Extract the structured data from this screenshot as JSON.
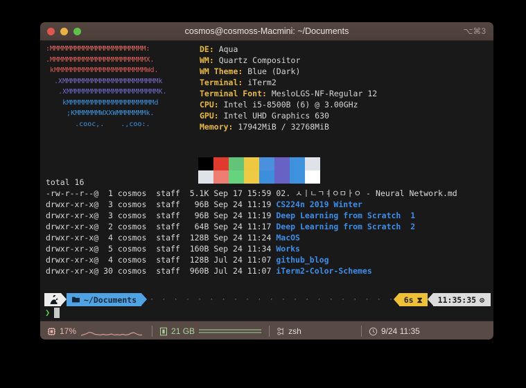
{
  "window": {
    "title": "cosmos@cosmoss-Macmini: ~/Documents",
    "shortcut": "⌥⌘3",
    "controls": {
      "close": "close-button",
      "minimize": "minimize-button",
      "maximize": "maximize-button"
    }
  },
  "neofetch": {
    "ascii_lines": [
      ":MMMMMMMMMMMMMMMMMMMMMMM:",
      ".MMMMMMMMMMMMMMMMMMMMMMMX.",
      " kMMMMMMMMMMMMMMMMMMMMMMWd.",
      "  .XMMMMMMMMMMMMMMMMMMMMMMMk",
      "   .XMMMMMMMMMMMMMMMMMMMMMMK.",
      "    kMMMMMMMMMMMMMMMMMMMMMd",
      "     ;KMMMMMMWXXWMMMMMMMk.",
      "       .cooc,.    .,coo:."
    ],
    "info": [
      {
        "key": "DE",
        "value": "Aqua"
      },
      {
        "key": "WM",
        "value": "Quartz Compositor"
      },
      {
        "key": "WM Theme",
        "value": "Blue (Dark)"
      },
      {
        "key": "Terminal",
        "value": "iTerm2"
      },
      {
        "key": "Terminal Font",
        "value": "MesloLGS-NF-Regular 12"
      },
      {
        "key": "CPU",
        "value": "Intel i5-8500B (6) @ 3.00GHz"
      },
      {
        "key": "GPU",
        "value": "Intel UHD Graphics 630"
      },
      {
        "key": "Memory",
        "value": "17942MiB / 32768MiB"
      }
    ],
    "palette": {
      "row1": [
        "#000000",
        "#e0392e",
        "#63c378",
        "#eec83f",
        "#4a90dd",
        "#6762c4",
        "#3f92dd",
        "#dfe2e8"
      ],
      "row2": [
        "#dfe2e8",
        "#ef7e72",
        "#66d37e",
        "#eecb42",
        "#3d8fdd",
        "#6762c4",
        "#3f92dd",
        "#ffffff"
      ]
    }
  },
  "ls": {
    "total": "total 16",
    "rows": [
      {
        "perms": "-rw-r--r--@",
        "links": " 1",
        "user": "cosmos",
        "group": "staff",
        "size": "5.1K",
        "month": "Sep",
        "day": "17",
        "time": "15:59",
        "name": "02. ㅅㅣㄴㄱㅕㅇㅁㅏㅇ - Neural Network.md",
        "kind": "file"
      },
      {
        "perms": "drwxr-xr-x@",
        "links": " 3",
        "user": "cosmos",
        "group": "staff",
        "size": "96B",
        "month": "Sep",
        "day": "24",
        "time": "11:19",
        "name": "CS224n 2019 Winter",
        "kind": "dir"
      },
      {
        "perms": "drwxr-xr-x@",
        "links": " 3",
        "user": "cosmos",
        "group": "staff",
        "size": "96B",
        "month": "Sep",
        "day": "24",
        "time": "11:19",
        "name": "Deep Learning from Scratch  1",
        "kind": "dir"
      },
      {
        "perms": "drwxr-xr-x@",
        "links": " 2",
        "user": "cosmos",
        "group": "staff",
        "size": "64B",
        "month": "Sep",
        "day": "24",
        "time": "11:17",
        "name": "Deep Learning from Scratch  2",
        "kind": "dir"
      },
      {
        "perms": "drwxr-xr-x@",
        "links": " 4",
        "user": "cosmos",
        "group": "staff",
        "size": "128B",
        "month": "Sep",
        "day": "24",
        "time": "11:24",
        "name": "MacOS",
        "kind": "dir"
      },
      {
        "perms": "drwxr-xr-x@",
        "links": " 5",
        "user": "cosmos",
        "group": "staff",
        "size": "160B",
        "month": "Sep",
        "day": "24",
        "time": "11:34",
        "name": "Works",
        "kind": "dir"
      },
      {
        "perms": "drwxr-xr-x@",
        "links": " 4",
        "user": "cosmos",
        "group": "staff",
        "size": "128B",
        "month": "Jul",
        "day": "24",
        "time": "11:07",
        "name": "github_blog",
        "kind": "dir"
      },
      {
        "perms": "drwxr-xr-x@",
        "links": "30",
        "user": "cosmos",
        "group": "staff",
        "size": "960B",
        "month": "Jul",
        "day": "24",
        "time": "11:07",
        "name": "iTerm2-Color-Schemes",
        "kind": "dir"
      }
    ]
  },
  "prompt": {
    "apple_icon": "apple-logo-icon",
    "folder_icon": "folder-icon",
    "path": "~/Documents",
    "dots": "· · · · · · · · · · · · · · · · · · · · · · · · · · · · · · · · · · · · · · · · · · ·",
    "duration": "6s",
    "hourglass_icon": "⧗",
    "clock_time": "11:35:35",
    "clock_icon": "⊙",
    "caret": "❯",
    "input_value": ""
  },
  "statusbar": {
    "cpu": {
      "icon": "cpu-chip-icon",
      "value": "17%"
    },
    "memory": {
      "icon": "memory-icon",
      "value": "21 GB"
    },
    "process": {
      "icon": "process-icon",
      "value": "zsh"
    },
    "clock": {
      "icon": "clock-icon",
      "value": "9/24 11:35"
    }
  },
  "colors": {
    "titlebar": "#54453f",
    "statusbar": "#584a45",
    "terminal_bg": "#191919",
    "accent_blue": "#3b8eea",
    "accent_yellow": "#e8b93c",
    "accent_green": "#4fd14f"
  }
}
